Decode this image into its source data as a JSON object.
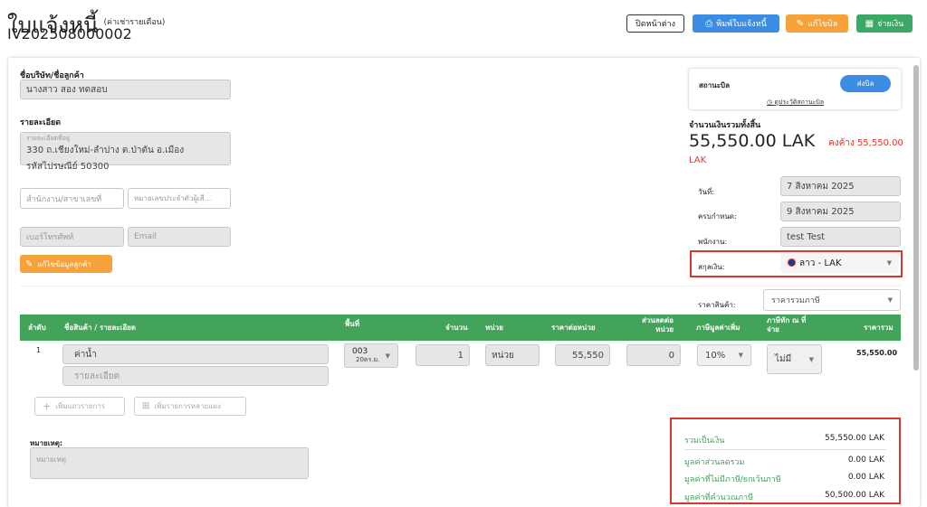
{
  "header": {
    "title": "ใบแจ้งหนี้",
    "subtitle": "(ค่าเช่ารายเดือน)",
    "doc_number": "IV202508000002",
    "buttons": {
      "close": "ปิดหน้าต่าง",
      "print": "พิมพ์ใบแจ้งหนี้",
      "edit": "แก้ไขบิล",
      "pay": "จ่ายเงิน"
    }
  },
  "customer": {
    "company_label": "ชื่อบริษัท/ชื่อลูกค้า",
    "company_value": "นางสาว สอง ทดสอบ",
    "detail_label": "รายละเอียด",
    "address_small_label": "รายละเอียดที่อยู่",
    "address_line1": "330 ถ.เชียงใหม่-ลำปาง ต.ป่าตัน อ.เมือง",
    "address_line2": "รหัสไปรษณีย์ 50300",
    "branch_placeholder": "สำนักงาน/สาขาเลขที่",
    "taxid_placeholder": "หมายเลขประจำตัวผู้เสี...",
    "phone_placeholder": "เบอร์โทรศัพท์",
    "email_placeholder": "Email",
    "edit_customer_button": "แก้ไขข้อมูลลูกค้า"
  },
  "status": {
    "label": "สถานะบิล",
    "badge": "ส่งบิล",
    "history_link": "ดูประวัติสถานะบิล"
  },
  "totals_panel": {
    "label": "จำนวนเงินรวมทั้งสิ้น",
    "amount": "55,550.00 LAK",
    "outstanding": "คงค้าง 55,550.00",
    "outstanding_currency": "LAK",
    "date_label": "วันที่:",
    "date_value": "7 สิงหาคม 2025",
    "due_label": "ครบกำหนด:",
    "due_value": "9 สิงหาคม 2025",
    "staff_label": "พนักงาน:",
    "staff_value": "test Test",
    "currency_label": "สกุลเงิน:",
    "currency_value": "ลาว - LAK",
    "price_label": "ราคาสินค้า:",
    "price_value": "ราคารวมภาษี"
  },
  "table": {
    "headers": [
      "ลำดับ",
      "ชื่อสินค้า / รายละเอียด",
      "พื้นที่",
      "จำนวน",
      "หน่วย",
      "ราคาต่อหน่วย",
      "ส่วนลดต่อหน่วย",
      "ภาษีมูลค่าเพิ่ม",
      "ภาษีหัก ณ ที่จ่าย",
      "ราคารวม"
    ],
    "row": {
      "index": "1",
      "name": "ค่าน้ำ",
      "detail_placeholder": "รายละเอียด",
      "area_code": "003",
      "area_size": "20ตร.ม.",
      "qty": "1",
      "unit": "หน่วย",
      "unit_price": "55,550",
      "discount": "0",
      "vat": "10%",
      "wht": "ไม่มี",
      "total": "55,550.00"
    },
    "add_row": "เพิ่มแถวรายการ",
    "add_multi": "เพิ่มรายการหลายแผง"
  },
  "notes": {
    "label": "หมายเหตุ:",
    "placeholder": "หมายเหตุ"
  },
  "summary": {
    "rows": [
      {
        "label": "รวมเป็นเงิน",
        "value": "55,550.00 LAK"
      },
      {
        "label": "มูลค่าส่วนลดรวม",
        "value": "0.00 LAK"
      },
      {
        "label": "มูลค่าที่ไม่มีภาษี/ยกเว้นภาษี",
        "value": "0.00 LAK"
      },
      {
        "label": "มูลค่าที่คำนวณภาษี",
        "value": "50,500.00 LAK"
      }
    ]
  },
  "colors": {
    "green": "#43a35a",
    "blue": "#3a8de3",
    "orange": "#f5a23a",
    "red": "#d9372c"
  }
}
